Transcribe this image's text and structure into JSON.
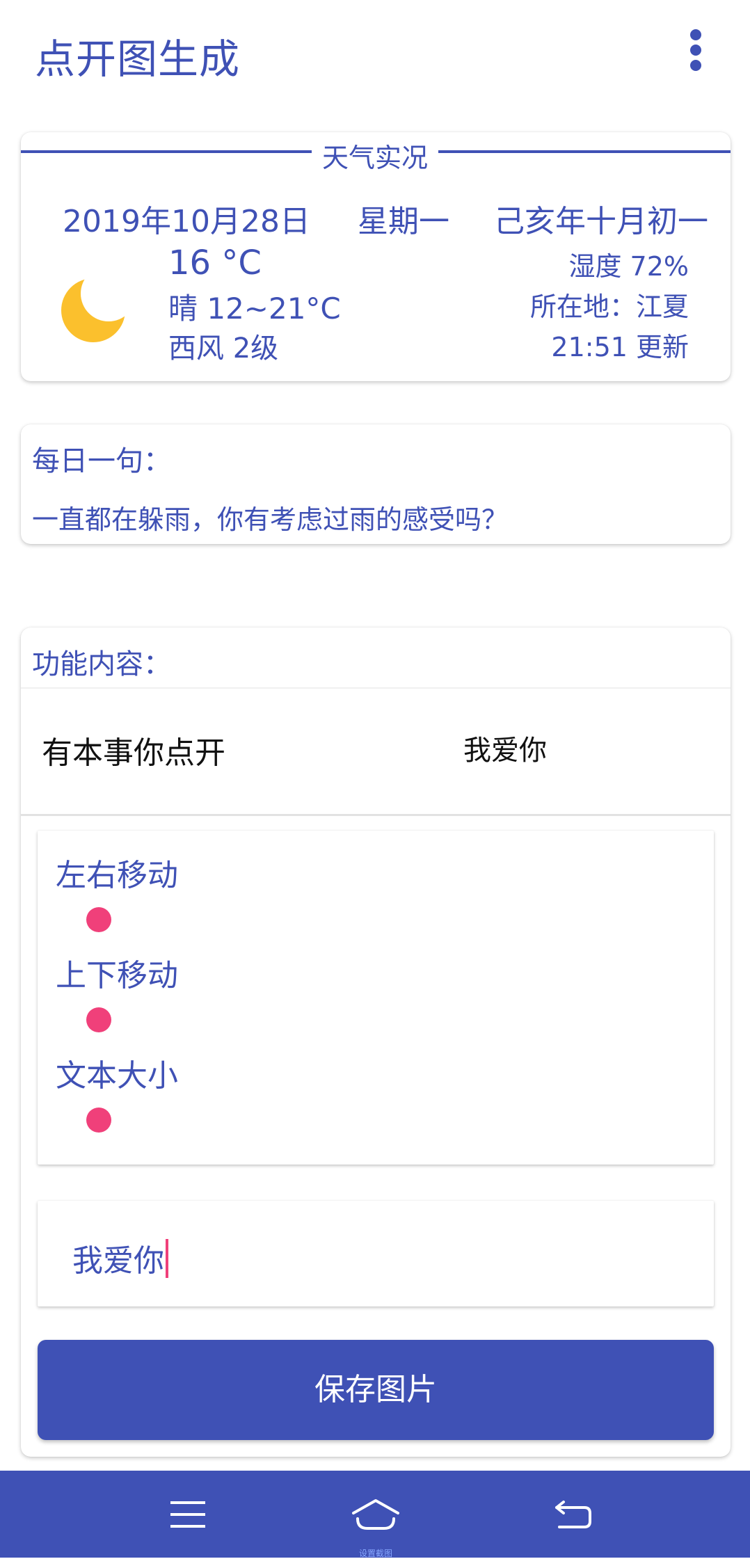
{
  "app": {
    "title": "点开图生成"
  },
  "weather": {
    "section_title": "天气实况",
    "date": "2019年10月28日",
    "weekday": "星期一",
    "lunar_date": "己亥年十月初一",
    "temperature": "16 °C",
    "condition_range": "晴 12~21°C",
    "wind": "西风 2级",
    "humidity": "湿度 72%",
    "location": "所在地：江夏",
    "updated": "21:51 更新",
    "icon": "moon-icon",
    "icon_color": "#fbc02d"
  },
  "daily": {
    "label": "每日一句：",
    "quote": "一直都在躲雨，你有考虑过雨的感受吗？"
  },
  "features": {
    "label": "功能内容：",
    "preview": {
      "title": "有本事你点开",
      "text": "我爱你"
    },
    "controls": [
      {
        "label": "左右移动"
      },
      {
        "label": "上下移动"
      },
      {
        "label": "文本大小"
      }
    ],
    "text_input_value": "我爱你",
    "save_button": "保存图片"
  },
  "navbar": {
    "home_label": "设置截图",
    "icons": [
      "menu-icon",
      "home-icon",
      "back-icon"
    ]
  },
  "colors": {
    "primary": "#3f51b5",
    "accent": "#f0407a",
    "sun": "#fbc02d"
  }
}
